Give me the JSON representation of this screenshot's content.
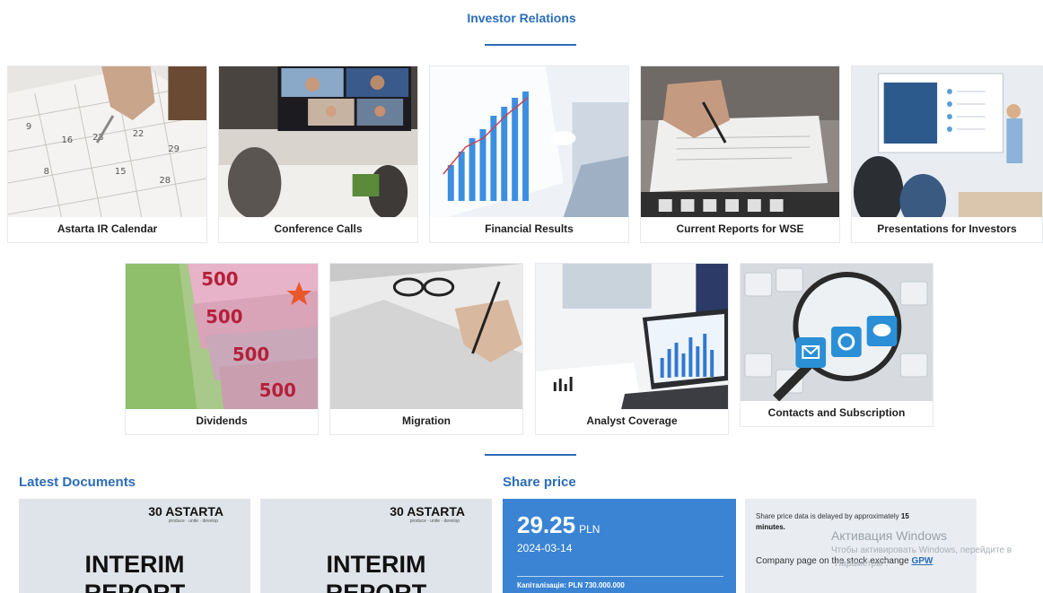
{
  "header": {
    "title": "Investor Relations"
  },
  "cards_row1": [
    {
      "label": "Astarta IR Calendar",
      "icon": "calendar-photo"
    },
    {
      "label": "Conference Calls",
      "icon": "video-conference-photo"
    },
    {
      "label": "Financial Results",
      "icon": "bar-chart-photo"
    },
    {
      "label": "Current Reports for WSE",
      "icon": "document-signing-photo"
    },
    {
      "label": "Presentations for Investors",
      "icon": "presentation-photo"
    }
  ],
  "cards_row2": [
    {
      "label": "Dividends",
      "icon": "euro-banknotes-photo"
    },
    {
      "label": "Migration",
      "icon": "glasses-pen-photo"
    },
    {
      "label": "Analyst Coverage",
      "icon": "laptop-charts-photo"
    },
    {
      "label": "Contacts and Subscription",
      "icon": "magnifier-keyboard-photo"
    }
  ],
  "latest_documents": {
    "title": "Latest Documents",
    "items": [
      {
        "brand": "30 ASTARTA",
        "tagline": "produce · unite · develop",
        "line1": "INTERIM",
        "line2": "REPORT"
      },
      {
        "brand": "30 ASTARTA",
        "tagline": "produce · unite · develop",
        "line1": "INTERIM",
        "line2": "REPORT"
      }
    ]
  },
  "share_price": {
    "title": "Share price",
    "value": "29.25",
    "currency": "PLN",
    "date": "2024-03-14",
    "capitalization": "Капіталізація: PLN 730.000.000",
    "delay_prefix": "Share price data is delayed by approximately ",
    "delay_value": "15",
    "delay_suffix": "minutes.",
    "stock_text": "Company page on the stock exchange ",
    "stock_link": "GPW"
  },
  "watermark": {
    "line1": "Активация Windows",
    "line2": "Чтобы активировать Windows, перейдите в",
    "line3": "Параметры\"."
  },
  "colors": {
    "accent": "#2b6cb8",
    "price_box": "#3a84d3"
  }
}
